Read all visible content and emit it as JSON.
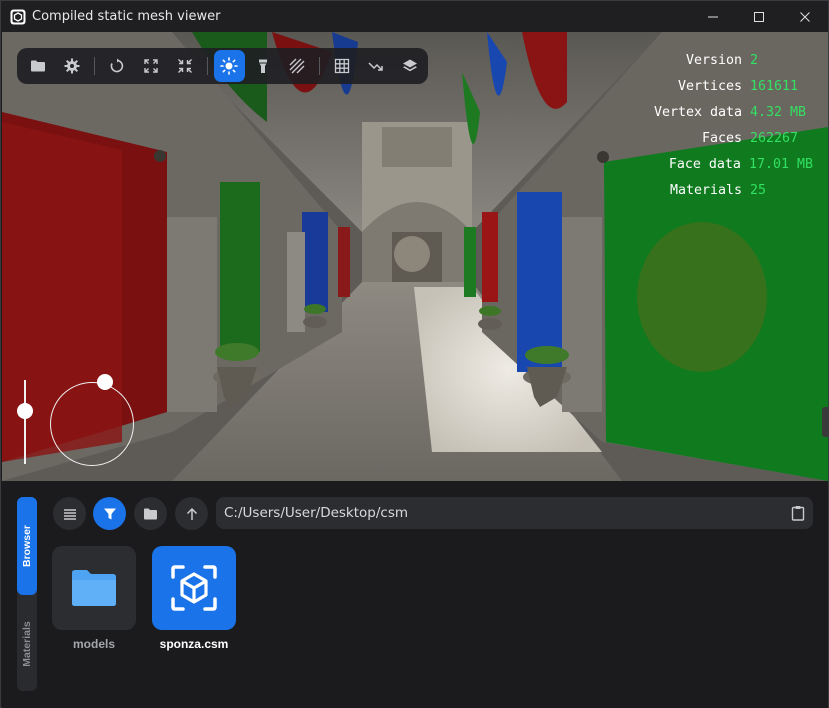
{
  "window": {
    "title": "Compiled static mesh viewer",
    "controls": [
      "minimize",
      "maximize",
      "close"
    ]
  },
  "toolbar": {
    "buttons": [
      {
        "icon": "folder-icon",
        "active": false
      },
      {
        "icon": "gear-icon",
        "active": false
      },
      {
        "icon": "reset-rotation-icon",
        "active": false
      },
      {
        "icon": "expand-icon",
        "active": false
      },
      {
        "icon": "collapse-icon",
        "active": false
      },
      {
        "icon": "sun-icon",
        "active": true
      },
      {
        "icon": "flashlight-icon",
        "active": false
      },
      {
        "icon": "hatch-icon",
        "active": false
      },
      {
        "icon": "grid-icon",
        "active": false
      },
      {
        "icon": "axis-arrow-icon",
        "active": false
      },
      {
        "icon": "layers-icon",
        "active": false
      }
    ]
  },
  "stats": [
    {
      "label": "Version",
      "value": "2"
    },
    {
      "label": "Vertices",
      "value": "161611"
    },
    {
      "label": "Vertex data",
      "value": "4.32 MB"
    },
    {
      "label": "Faces",
      "value": "262267"
    },
    {
      "label": "Face data",
      "value": "17.01 MB"
    },
    {
      "label": "Materials",
      "value": "25"
    }
  ],
  "colors": {
    "accent": "#1a73e8",
    "stat_value": "#33e061"
  },
  "browser": {
    "tabs": [
      "Browser",
      "Materials"
    ],
    "active_tab": "Browser",
    "path": "C:/Users/User/Desktop/csm",
    "items": [
      {
        "name": "models",
        "type": "folder",
        "selected": false
      },
      {
        "name": "sponza.csm",
        "type": "mesh",
        "selected": true
      }
    ]
  }
}
